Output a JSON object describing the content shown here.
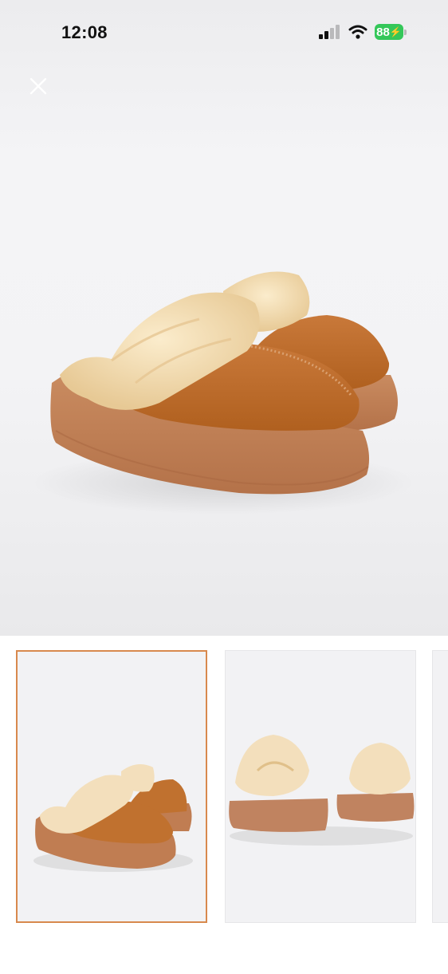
{
  "status_bar": {
    "time": "12:08",
    "battery": "88",
    "icons": [
      "cellular-signal-icon",
      "wifi-icon",
      "battery-charging-icon"
    ]
  },
  "colors": {
    "battery": "#34c759",
    "selected_thumb_border": "#d8894d",
    "suede": "#c0712f",
    "sole": "#c07d52",
    "fur": "#f3dfbc"
  },
  "gallery": {
    "close_icon": "close-icon",
    "selected_index": 0,
    "thumbnails": [
      "slippers-angle",
      "slippers-back",
      "slippers-partial"
    ]
  }
}
